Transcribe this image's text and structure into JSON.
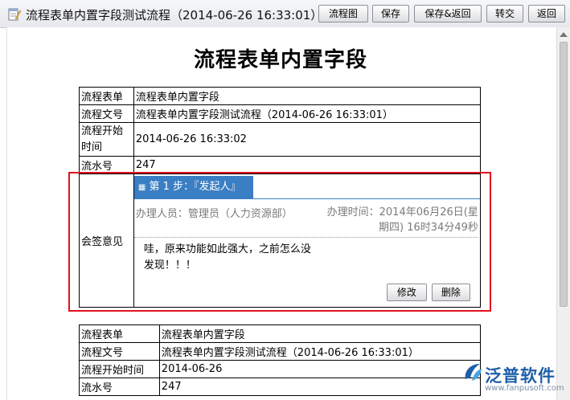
{
  "window": {
    "title": "流程表单内置字段测试流程（2014-06-26 16:33:01）",
    "buttons": {
      "flowchart": "流程图",
      "save": "保存",
      "save_return": "保存&返回",
      "transfer": "转交",
      "back": "返回"
    }
  },
  "page_heading": "流程表单内置字段",
  "form1": {
    "rows": [
      {
        "label": "流程表单",
        "value": "流程表单内置字段"
      },
      {
        "label": "流程文号",
        "value": "流程表单内置字段测试流程（2014-06-26 16:33:01）"
      },
      {
        "label": "流程开始时间",
        "value": "2014-06-26 16:33:02"
      },
      {
        "label": "流水号",
        "value": "247"
      }
    ],
    "sign_label": "会签意见",
    "sign": {
      "step_text": "第 1 步：『发起人』",
      "handler": "办理人员：管理员（人力资源部）",
      "handle_time": "办理时间：2014年06月26日(星期四) 16时34分49秒",
      "comment": "哇，原来功能如此强大，之前怎么没发现！！！",
      "edit_label": "修改",
      "delete_label": "删除"
    }
  },
  "form2": {
    "rows": [
      {
        "label": "流程表单",
        "value": "流程表单内置字段"
      },
      {
        "label": "流程文号",
        "value": "流程表单内置字段测试流程（2014-06-26 16:33:01）"
      },
      {
        "label": "流程开始时间",
        "value": "2014-06-26"
      },
      {
        "label": "流水号",
        "value": "247"
      }
    ]
  },
  "watermark": {
    "name": "泛普软件",
    "url": "www.fanpusoft.com"
  },
  "colors": {
    "accent": "#3a7ec4",
    "highlight": "#e0131c",
    "logo": "#1f5fa8"
  },
  "icons": {
    "title_icon": "document-edit-icon",
    "step_icon": "close-box-icon",
    "logo_icon": "fanpu-logo-icon"
  }
}
